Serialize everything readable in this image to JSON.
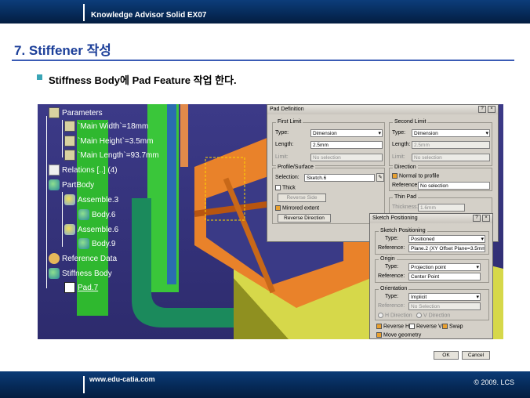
{
  "slide": {
    "header_title": "Knowledge Advisor Solid  EX07",
    "heading": "7. Stiffener 작성",
    "bullet": "Stiffness Body에 Pad Feature 작업 한다.",
    "footer_url": "www.edu-catia.com",
    "footer_copy": "© 2009. LCS"
  },
  "tree": {
    "parameters": "Parameters",
    "main_width": "`Main Width`=18mm",
    "main_height": "`Main Height`=3.5mm",
    "main_length": "`Main Length`=93.7mm",
    "relations": "Relations [..] (4)",
    "partbody": "PartBody",
    "assemble3": "Assemble.3",
    "body6": "Body.6",
    "assemble6": "Assemble.6",
    "body9": "Body.9",
    "reference_data": "Reference Data",
    "stiffness_body": "Stiffness Body",
    "pad7": "Pad.7"
  },
  "pad_dialog": {
    "title": "Pad Definition",
    "first_limit": "First Limit",
    "second_limit": "Second Limit",
    "type_label": "Type:",
    "length_label": "Length:",
    "limit_label": "Limit:",
    "first_type": "Dimension",
    "first_length": "2.5mm",
    "first_limit_value": "No selection",
    "second_type": "Dimension",
    "second_length": "2.5mm",
    "second_limit_value": "No selection",
    "profile_surface": "Profile/Surface",
    "selection_label": "Selection:",
    "selection_value": "Sketch.6",
    "thick": "Thick",
    "reverse_side": "Reverse Side",
    "mirrored_extent": "Mirrored extent",
    "reverse_direction": "Reverse Direction",
    "direction": "Direction",
    "normal_to_profile": "Normal to profile",
    "reference_label": "Reference:",
    "direction_reference": "No selection",
    "thin_pad": "Thin Pad",
    "thickness1_label": "Thickness1:",
    "thickness1_value": "1.6mm"
  },
  "sketch_dialog": {
    "title": "Sketch Positioning",
    "sketch_positioning": "Sketch Positioning",
    "type_label": "Type:",
    "reference_label": "Reference:",
    "sp_type": "Positioned",
    "sp_reference": "Plane.2 (XY Offset Plane=3.5mm)",
    "origin": "Origin",
    "origin_type": "Projection point",
    "origin_reference": "Center Point",
    "orientation": "Orientation",
    "orientation_type": "Implicit",
    "orientation_reference": "No Selection",
    "h_direction": "H Direction",
    "v_direction": "V Direction",
    "reverse_h": "Reverse H",
    "reverse_v": "Reverse V",
    "swap": "Swap",
    "move_geometry": "Move geometry",
    "ok": "OK",
    "cancel": "Cancel"
  },
  "colors": {
    "accent": "#1c3f99",
    "band": "#062a58",
    "viewport_bg": "#3c3a88"
  }
}
